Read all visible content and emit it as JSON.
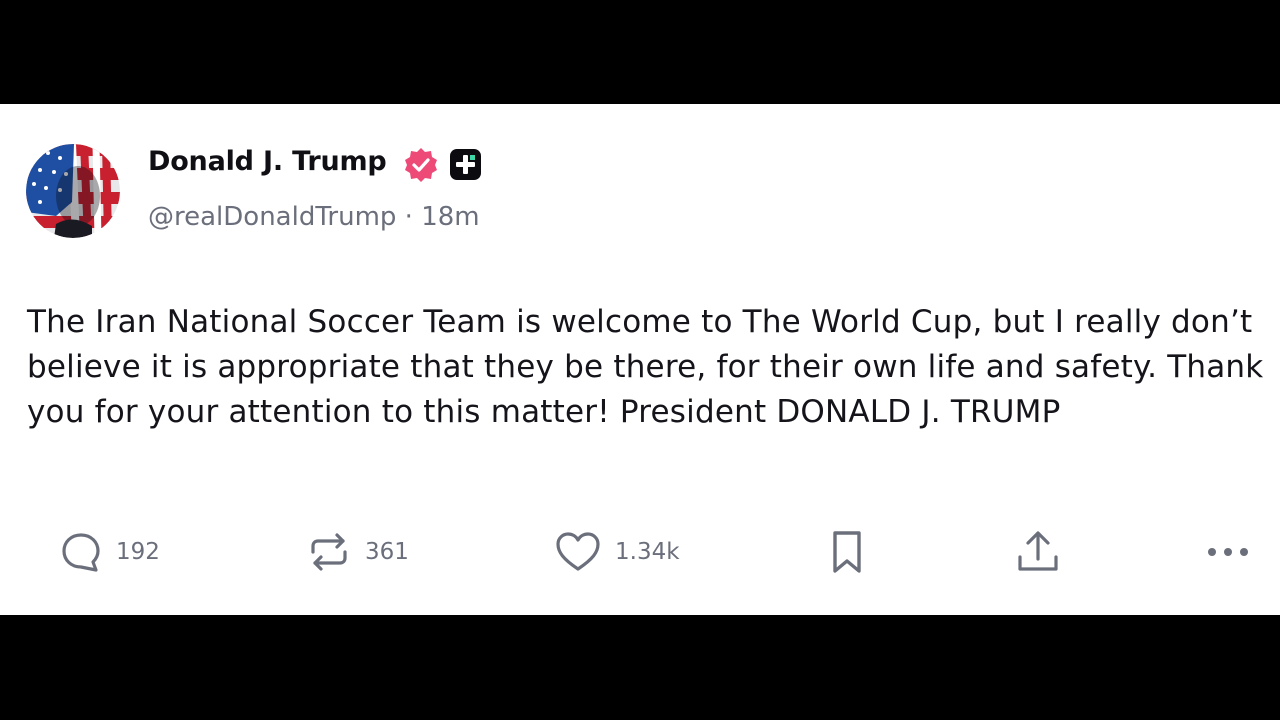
{
  "post": {
    "author_name": "Donald J. Trump",
    "handle": "@realDonaldTrump",
    "separator": "·",
    "time_ago": "18m",
    "text": "The Iran National Soccer Team is welcome to The World Cup, but I really don’t believe it is appropriate that they be there, for their own life and safety. Thank you for your attention to this matter! President DONALD J. TRUMP"
  },
  "icons": {
    "verified": "verified-badge-icon",
    "plus": "plus-badge-icon",
    "reply": "speech-bubble-icon",
    "repost": "repost-arrows-icon",
    "like": "heart-icon",
    "bookmark": "bookmark-icon",
    "share": "share-upload-icon",
    "more": "more-dots-icon"
  },
  "actions": {
    "replies": "192",
    "reposts": "361",
    "likes": "1.34k"
  },
  "colors": {
    "verified": "#ee4a78",
    "icon": "#6b6f7b",
    "text": "#14141a",
    "background": "#ffffff",
    "letterbox": "#000000"
  }
}
